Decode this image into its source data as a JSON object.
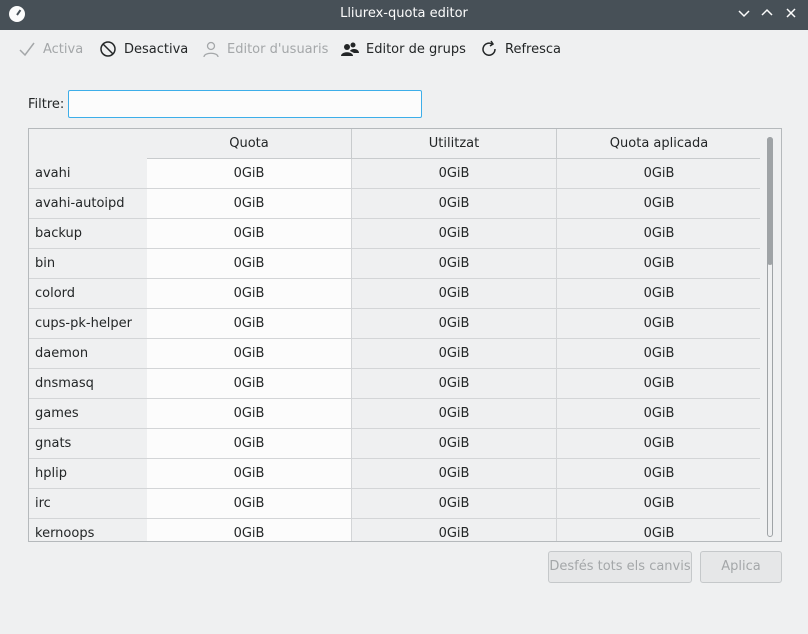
{
  "window": {
    "title": "Lliurex-quota editor"
  },
  "toolbar": {
    "activate": "Activa",
    "deactivate": "Desactiva",
    "user_editor": "Editor d'usuaris",
    "group_editor": "Editor de grups",
    "refresh": "Refresca"
  },
  "filter": {
    "label": "Filtre:",
    "value": ""
  },
  "table": {
    "headers": [
      "Quota",
      "Utilitzat",
      "Quota aplicada"
    ],
    "rows": [
      {
        "name": "avahi",
        "quota": "0GiB",
        "used": "0GiB",
        "applied": "0GiB"
      },
      {
        "name": "avahi-autoipd",
        "quota": "0GiB",
        "used": "0GiB",
        "applied": "0GiB"
      },
      {
        "name": "backup",
        "quota": "0GiB",
        "used": "0GiB",
        "applied": "0GiB"
      },
      {
        "name": "bin",
        "quota": "0GiB",
        "used": "0GiB",
        "applied": "0GiB"
      },
      {
        "name": "colord",
        "quota": "0GiB",
        "used": "0GiB",
        "applied": "0GiB"
      },
      {
        "name": "cups-pk-helper",
        "quota": "0GiB",
        "used": "0GiB",
        "applied": "0GiB"
      },
      {
        "name": "daemon",
        "quota": "0GiB",
        "used": "0GiB",
        "applied": "0GiB"
      },
      {
        "name": "dnsmasq",
        "quota": "0GiB",
        "used": "0GiB",
        "applied": "0GiB"
      },
      {
        "name": "games",
        "quota": "0GiB",
        "used": "0GiB",
        "applied": "0GiB"
      },
      {
        "name": "gnats",
        "quota": "0GiB",
        "used": "0GiB",
        "applied": "0GiB"
      },
      {
        "name": "hplip",
        "quota": "0GiB",
        "used": "0GiB",
        "applied": "0GiB"
      },
      {
        "name": "irc",
        "quota": "0GiB",
        "used": "0GiB",
        "applied": "0GiB"
      },
      {
        "name": "kernoops",
        "quota": "0GiB",
        "used": "0GiB",
        "applied": "0GiB"
      }
    ]
  },
  "buttons": {
    "undo_all": "Desfés tots els canvis",
    "apply": "Aplica"
  },
  "colors": {
    "titlebar": "#475057",
    "accent": "#3daee9",
    "disabled_text": "#a4a7a9"
  }
}
